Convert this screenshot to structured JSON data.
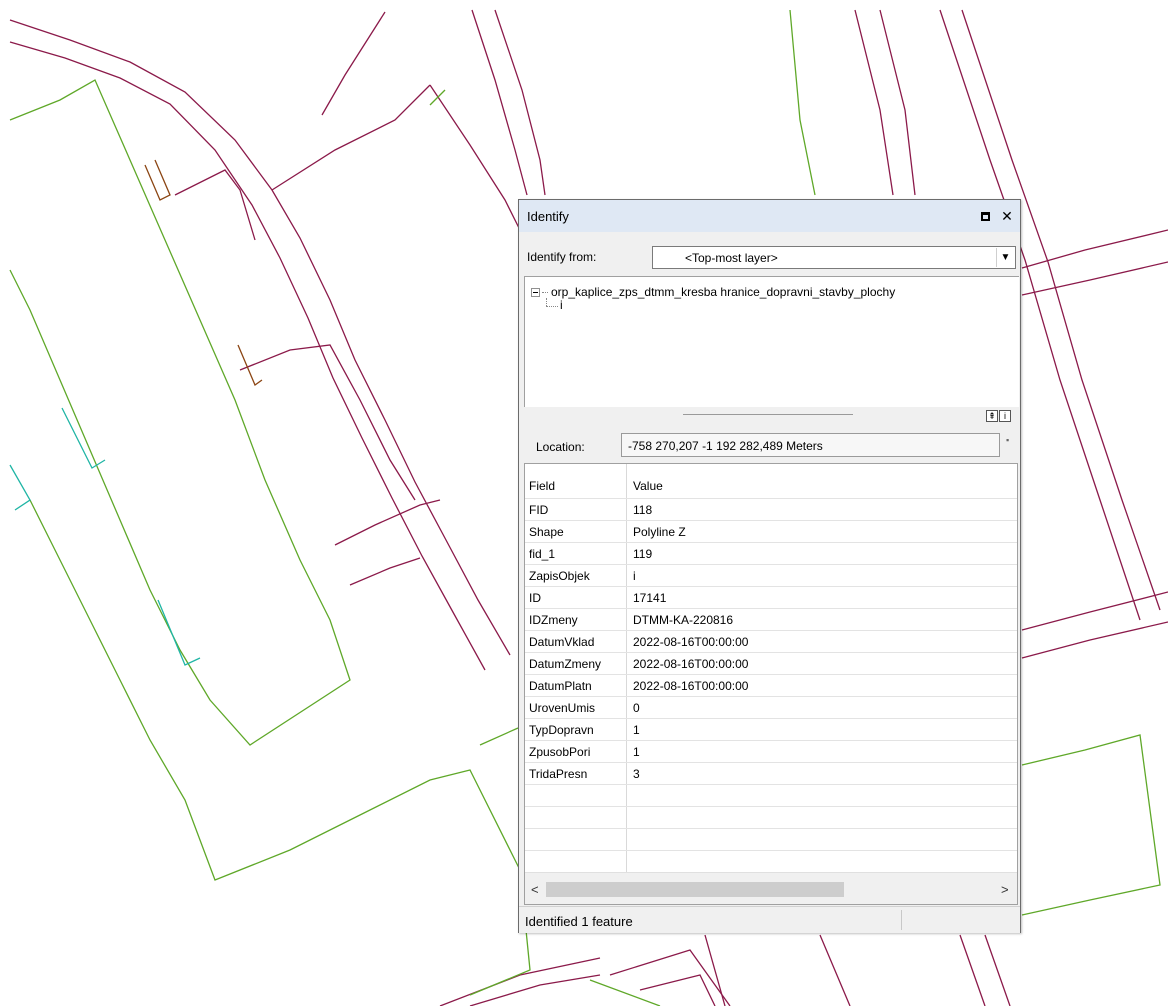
{
  "window": {
    "title": "Identify",
    "maximize_icon": "maximize-icon",
    "close_icon": "close-icon",
    "close_glyph": "✕"
  },
  "identify_from": {
    "label": "Identify from:",
    "value": "<Top-most layer>",
    "dropdown_glyph": "▼"
  },
  "tree": {
    "layer_name": "orp_kaplice_zps_dtmm_kresba hranice_dopravni_stavby_plochy",
    "child_label": "i"
  },
  "split_icons": {
    "collapse_glyph": "⇞",
    "info_glyph": "i"
  },
  "location": {
    "label": "Location:",
    "value": "-758 270,207  -1 192 282,489 Meters",
    "corner_glyph": "▪"
  },
  "grid": {
    "headers": [
      "Field",
      "Value"
    ],
    "rows": [
      [
        "FID",
        "118"
      ],
      [
        "Shape",
        "Polyline Z"
      ],
      [
        "fid_1",
        "119"
      ],
      [
        "ZapisObjek",
        "i"
      ],
      [
        "ID",
        "17141"
      ],
      [
        "IDZmeny",
        "DTMM-KA-220816"
      ],
      [
        "DatumVklad",
        "2022-08-16T00:00:00"
      ],
      [
        "DatumZmeny",
        "2022-08-16T00:00:00"
      ],
      [
        "DatumPlatn",
        "2022-08-16T00:00:00"
      ],
      [
        "UrovenUmis",
        "0"
      ],
      [
        "TypDopravn",
        "1"
      ],
      [
        "ZpusobPori",
        "1"
      ],
      [
        "TridaPresn",
        "3"
      ]
    ],
    "scroll_left_glyph": "<",
    "scroll_right_glyph": ">"
  },
  "status": {
    "text": "Identified 1 feature"
  },
  "colors": {
    "road_line": "#8b1a4a",
    "green_line": "#5fa829",
    "cyan_line": "#1fb5a5",
    "brown_line": "#8b4513",
    "titlebar": "#dfe8f4"
  }
}
